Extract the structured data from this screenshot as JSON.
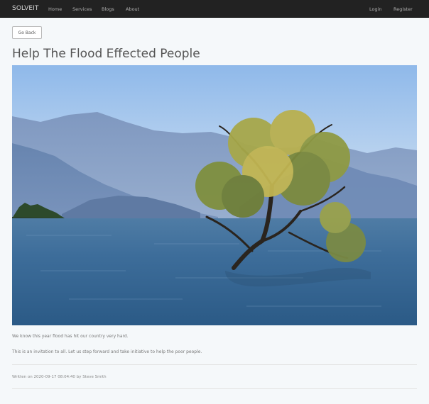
{
  "navbar": {
    "brand": "SOLVEIT",
    "links": [
      "Home",
      "Services",
      "Blogs",
      "About"
    ],
    "right_links": [
      "Login",
      "Register"
    ]
  },
  "actions": {
    "go_back_label": "Go Back"
  },
  "post": {
    "title": "Help The Flood Effected People",
    "image_subject": "lone tree standing in lake water with mountains behind",
    "body": [
      "We know this year flood has hit our country very hard.",
      "This is an invitation to all. Let us step forward and take initiative to help the poor people."
    ],
    "meta": {
      "prefix": "Written on",
      "date": "2020-09-17 08:04:40",
      "by_label": "by",
      "author": "Steve Smith"
    }
  },
  "colors": {
    "navbar_bg": "#222222",
    "page_bg": "#f5f8fa",
    "title_text": "#555555"
  }
}
